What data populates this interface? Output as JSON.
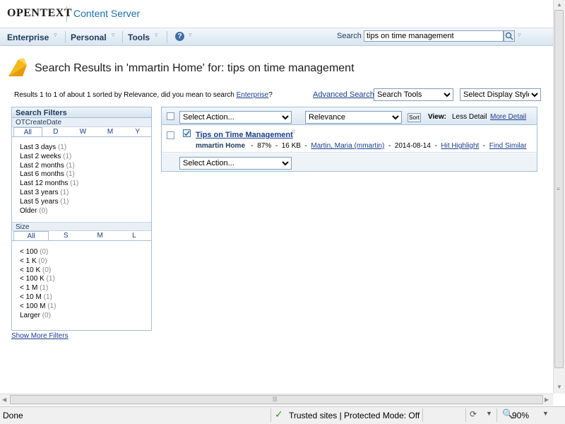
{
  "header": {
    "brand": "OpenText",
    "product": "Content Server"
  },
  "nav": {
    "enterprise": "Enterprise",
    "personal": "Personal",
    "tools": "Tools",
    "help": "?",
    "search_label": "Search",
    "search_value": "tips on time management"
  },
  "page": {
    "title": "Search Results in 'mmartin Home' for: tips on time management",
    "summary_prefix": "Results 1 to 1 of about 1 sorted by Relevance, did you mean to search ",
    "summary_link": "Enterprise",
    "summary_suffix": "?",
    "advanced_search": "Advanced Search",
    "search_tools": "Search Tools",
    "display_style": "Select Display Style"
  },
  "filters": {
    "heading": "Search Filters",
    "date": {
      "heading": "OTCreateDate",
      "tabs": [
        "All",
        "D",
        "W",
        "M",
        "Y"
      ],
      "items": [
        {
          "label": "Last 3 days",
          "count": "(1)"
        },
        {
          "label": "Last 2 weeks",
          "count": "(1)"
        },
        {
          "label": "Last 2 months",
          "count": "(1)"
        },
        {
          "label": "Last 6 months",
          "count": "(1)"
        },
        {
          "label": "Last 12 months",
          "count": "(1)"
        },
        {
          "label": "Last 3 years",
          "count": "(1)"
        },
        {
          "label": "Last 5 years",
          "count": "(1)"
        },
        {
          "label": "Older",
          "count": "(0)"
        }
      ]
    },
    "size": {
      "heading": "Size",
      "tabs": [
        "All",
        "S",
        "M",
        "L"
      ],
      "items": [
        {
          "label": "< 100",
          "count": "(0)"
        },
        {
          "label": "< 1 K",
          "count": "(0)"
        },
        {
          "label": "< 10 K",
          "count": "(0)"
        },
        {
          "label": "< 100 K",
          "count": "(1)"
        },
        {
          "label": "< 1 M",
          "count": "(1)"
        },
        {
          "label": "< 10 M",
          "count": "(1)"
        },
        {
          "label": "< 100 M",
          "count": "(1)"
        },
        {
          "label": "Larger",
          "count": "(0)"
        }
      ]
    },
    "show_more": "Show More Filters"
  },
  "results": {
    "select_action": "Select Action...",
    "sort_by": "Relevance",
    "sort_button": "Sort",
    "view_label": "View:",
    "less_detail": "Less Detail",
    "more_detail": "More Detail",
    "item": {
      "title": "Tips on Time Management",
      "location": "mmartin Home",
      "relevance": "87%",
      "size": "16 KB",
      "owner": "Martin, Maria (mmartin)",
      "date": "2014-08-14",
      "hit_highlight": "Hit Highlight",
      "find_similar": "Find Similar"
    },
    "bottom_select_action": "Select Action..."
  },
  "statusbar": {
    "status": "Done",
    "zone": "Trusted sites | Protected Mode: Off",
    "zoom": "90%"
  }
}
